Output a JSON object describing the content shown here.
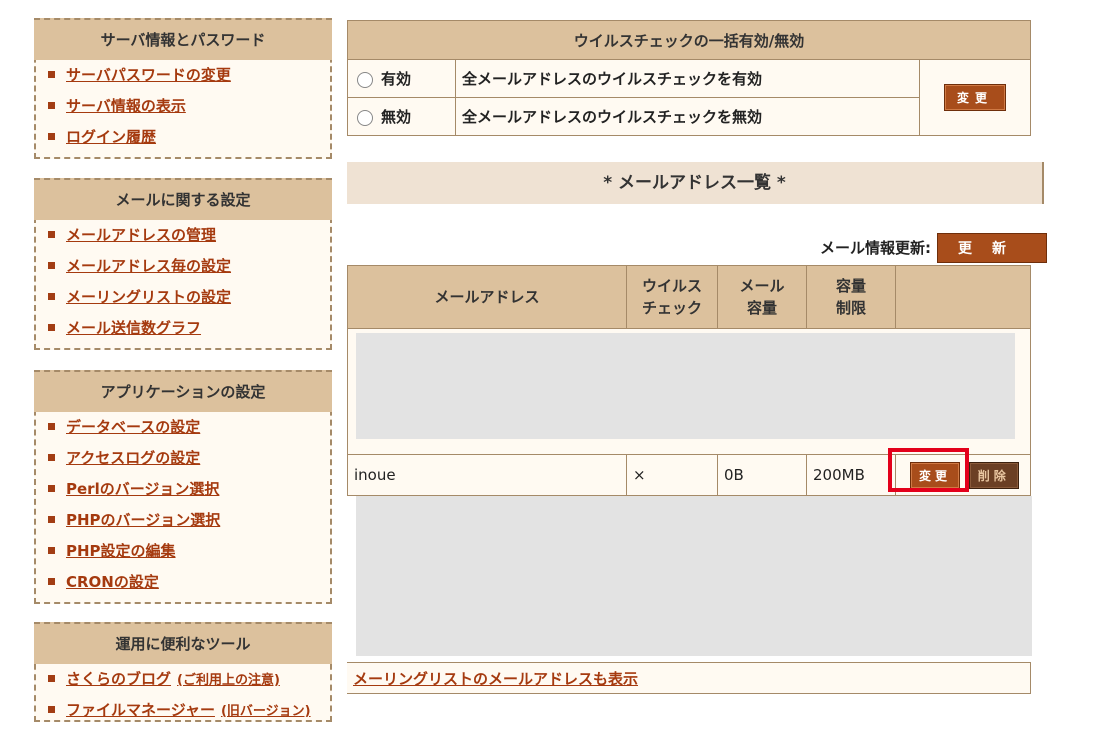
{
  "sidebar": {
    "server": {
      "title": "サーバ情報とパスワード",
      "items": [
        "サーバパスワードの変更",
        "サーバ情報の表示",
        "ログイン履歴"
      ]
    },
    "mail": {
      "title": "メールに関する設定",
      "items": [
        "メールアドレスの管理",
        "メールアドレス毎の設定",
        "メーリングリストの設定",
        "メール送信数グラフ"
      ]
    },
    "app": {
      "title": "アプリケーションの設定",
      "items": [
        "データベースの設定",
        "アクセスログの設定",
        "Perlのバージョン選択",
        "PHPのバージョン選択",
        "PHP設定の編集",
        "CRONの設定"
      ]
    },
    "tools": {
      "title": "運用に便利なツール",
      "items": [
        "さくらのブログ",
        "ファイルマネージャー"
      ],
      "blog_note": "(ご利用上の注意)",
      "fm_note": "(旧バージョン)"
    }
  },
  "virus_check": {
    "title": "ウイルスチェックの一括有効/無効",
    "rows": [
      {
        "label": "有効",
        "desc": "全メールアドレスのウイルスチェックを有効"
      },
      {
        "label": "無効",
        "desc": "全メールアドレスのウイルスチェックを無効"
      }
    ],
    "change_label": "変更"
  },
  "list": {
    "title": "* メールアドレス一覧 *",
    "refresh_label": "メール情報更新:",
    "refresh_button": "更新",
    "headers": {
      "address": "メールアドレス",
      "virus_line1": "ウイルス",
      "virus_line2": "チェック",
      "mail_line1": "メール",
      "mail_line2": "容量",
      "limit_line1": "容量",
      "limit_line2": "制限"
    },
    "row": {
      "address": "inoue",
      "virus": "×",
      "mail_size": "0B",
      "limit": "200MB",
      "change": "変更",
      "delete": "削除"
    },
    "ml_link": "メーリングリストのメールアドレスも表示"
  },
  "colors": {
    "header_bg": "#dcc19d",
    "link": "#a53a0f",
    "button": "#a84d1b",
    "highlight": "#e3001b"
  }
}
